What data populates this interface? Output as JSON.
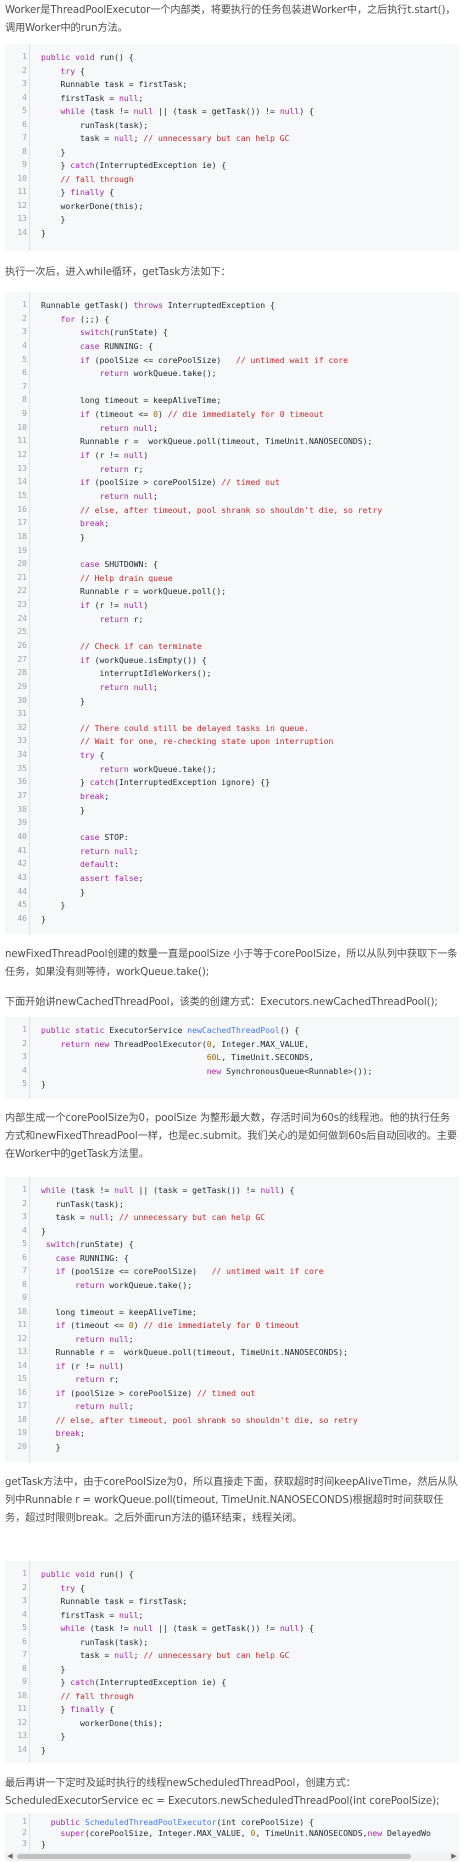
{
  "paragraphs": [
    "Worker是ThreadPoolExecutor一个内部类，将要执行的任务包装进Worker中，之后执行t.start()，调用Worker中的run方法。",
    "执行一次后，进入while循环，getTask方法如下：",
    "newFixedThreadPool创建的数量一直是poolSize 小于等于corePoolSize，所以从队列中获取下一条任务，如果没有则等待，workQueue.take();",
    "下面开始讲newCachedThreadPool，该类的创建方式：Executors.newCachedThreadPool();",
    "内部生成一个corePoolSize为0，poolSize 为整形最大数，存活时间为60s的线程池。他的执行任务方式和newFixedThreadPool一样，也是ec.submit。我们关心的是如何做到60s后自动回收的。主要在Worker中的getTask方法里。",
    "getTask方法中，由于corePoolSize为0，所以直接走下面，获取超时时间keepAliveTime，然后从队列中Runnable r = workQueue.poll(timeout, TimeUnit.NANOSECONDS)根据超时时间获取任务，超过时限则break。之后外面run方法的循环结束，线程关闭。",
    "最后再讲一下定时及延时执行的线程newScheduledThreadPool，创建方式：ScheduledExecutorService ec = Executors.newScheduledThreadPool(int corePoolSize);"
  ],
  "code_blocks": [
    {
      "lines": [
        "public void run() {",
        "    try {",
        "    Runnable task = firstTask;",
        "    firstTask = null;",
        "    while (task != null || (task = getTask()) != null) {",
        "        runTask(task);",
        "        task = null; // unnecessary but can help GC",
        "    }",
        "    } catch(InterruptedException ie) {",
        "    // fall through",
        "    } finally {",
        "    workerDone(this);",
        "    }",
        "}"
      ]
    },
    {
      "lines": [
        "Runnable getTask() throws InterruptedException {",
        "    for (;;) {",
        "        switch(runState) {",
        "        case RUNNING: {",
        "        if (poolSize <= corePoolSize)   // untimed wait if core",
        "            return workQueue.take();",
        "",
        "        long timeout = keepAliveTime;",
        "        if (timeout <= 0) // die immediately for 0 timeout",
        "            return null;",
        "        Runnable r =  workQueue.poll(timeout, TimeUnit.NANOSECONDS);",
        "        if (r != null)",
        "            return r;",
        "        if (poolSize > corePoolSize) // timed out",
        "            return null;",
        "        // else, after timeout, pool shrank so shouldn't die, so retry",
        "        break;",
        "        }",
        "",
        "        case SHUTDOWN: {",
        "        // Help drain queue",
        "        Runnable r = workQueue.poll();",
        "        if (r != null)",
        "            return r;",
        "",
        "        // Check if can terminate",
        "        if (workQueue.isEmpty()) {",
        "            interruptIdleWorkers();",
        "            return null;",
        "        }",
        "",
        "        // There could still be delayed tasks in queue.",
        "        // Wait for one, re-checking state upon interruption",
        "        try {",
        "            return workQueue.take();",
        "        } catch(InterruptedException ignore) {}",
        "        break;",
        "        }",
        "",
        "        case STOP:",
        "        return null;",
        "        default:",
        "        assert false;",
        "        }",
        "    }",
        "}"
      ]
    },
    {
      "lines": [
        "public static ExecutorService newCachedThreadPool() {",
        "    return new ThreadPoolExecutor(0, Integer.MAX_VALUE,",
        "                                  60L, TimeUnit.SECONDS,",
        "                                  new SynchronousQueue<Runnable>());",
        "}"
      ]
    },
    {
      "lines": [
        "while (task != null || (task = getTask()) != null) {",
        "   runTask(task);",
        "   task = null; // unnecessary but can help GC",
        "}",
        " switch(runState) {",
        "   case RUNNING: {",
        "   if (poolSize <= corePoolSize)   // untimed wait if core",
        "       return workQueue.take();",
        "",
        "   long timeout = keepAliveTime;",
        "   if (timeout <= 0) // die immediately for 0 timeout",
        "       return null;",
        "   Runnable r =  workQueue.poll(timeout, TimeUnit.NANOSECONDS);",
        "   if (r != null)",
        "       return r;",
        "   if (poolSize > corePoolSize) // timed out",
        "       return null;",
        "   // else, after timeout, pool shrank so shouldn't die, so retry",
        "   break;",
        "   }"
      ]
    },
    {
      "lines": [
        "public void run() {",
        "    try {",
        "    Runnable task = firstTask;",
        "    firstTask = null;",
        "    while (task != null || (task = getTask()) != null) {",
        "        runTask(task);",
        "        task = null; // unnecessary but can help GC",
        "    }",
        "    } catch(InterruptedException ie) {",
        "    // fall through",
        "    } finally {",
        "        workerDone(this);",
        "    }",
        "}"
      ]
    },
    {
      "lines": [
        "  public ScheduledThreadPoolExecutor(int corePoolSize) {",
        "    super(corePoolSize, Integer.MAX_VALUE, 0, TimeUnit.NANOSECONDS,new DelayedWo",
        "}"
      ]
    }
  ],
  "scrollbar": {
    "left_arrow": "◀",
    "right_arrow": "▶"
  }
}
